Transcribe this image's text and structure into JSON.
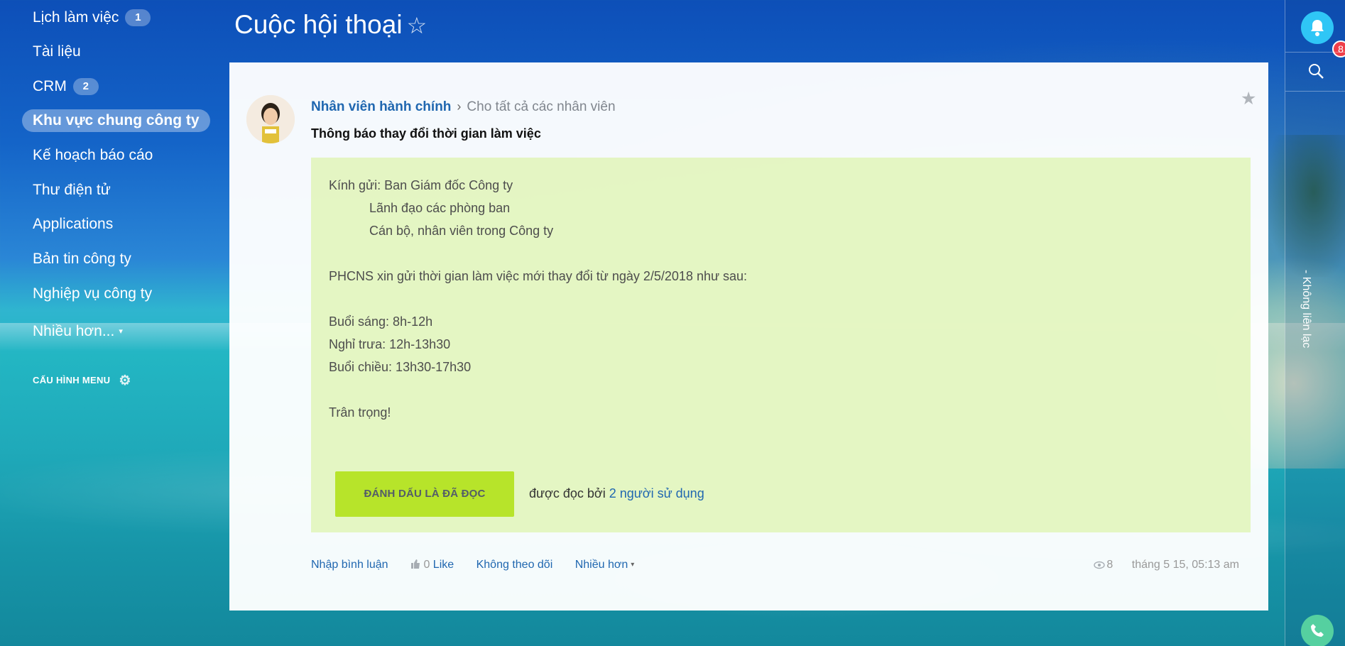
{
  "sidebar": {
    "items": [
      {
        "label": "Lịch làm việc",
        "counter": "1"
      },
      {
        "label": "Tài liệu"
      },
      {
        "label": "CRM",
        "counter": "2"
      },
      {
        "label": "Khu vực chung công ty",
        "active": true
      },
      {
        "label": "Kế hoạch báo cáo"
      },
      {
        "label": "Thư điện tử"
      },
      {
        "label": "Applications"
      },
      {
        "label": "Bản tin công ty"
      },
      {
        "label": "Nghiệp vụ công ty"
      },
      {
        "label": "Nhiều hơn..."
      }
    ],
    "config_label": "CẤU HÌNH MENU"
  },
  "header": {
    "title": "Cuộc hội thoại"
  },
  "right_rail": {
    "notification_count": "8",
    "vertical_text": "- Không liên lạc"
  },
  "post": {
    "author": "Nhân viên hành chính",
    "recipient": "Cho tất cả các nhân viên",
    "title": "Thông báo thay đổi thời gian làm việc",
    "body_lines": [
      "Kính gửi: Ban Giám đốc Công ty",
      "Lãnh đạo các phòng ban",
      "Cán bộ, nhân viên trong Công ty",
      "PHCNS xin gửi thời gian làm việc mới thay đổi từ ngày 2/5/2018 như sau:",
      "Buổi sáng: 8h-12h",
      "Nghỉ trưa: 12h-13h30",
      "Buổi chiều: 13h30-17h30",
      "Trân trọng!"
    ],
    "mark_read_label": "ĐÁNH DẤU LÀ ĐÃ ĐỌC",
    "read_by_prefix": "được đọc bởi",
    "read_by_link": "2 người sử dụng",
    "footer": {
      "comment_label": "Nhập bình luận",
      "like_count": "0",
      "like_label": "Like",
      "unfollow_label": "Không theo dõi",
      "more_label": "Nhiều hơn"
    },
    "views": "8",
    "date": "tháng 5 15, 05:13 am"
  },
  "colors": {
    "link": "#2067b0",
    "mark_read_button": "#b7e42a",
    "notification_badge": "#ef3f4a",
    "bell_bg": "#2fc6f6",
    "body_bg": "#e1f5b9"
  }
}
